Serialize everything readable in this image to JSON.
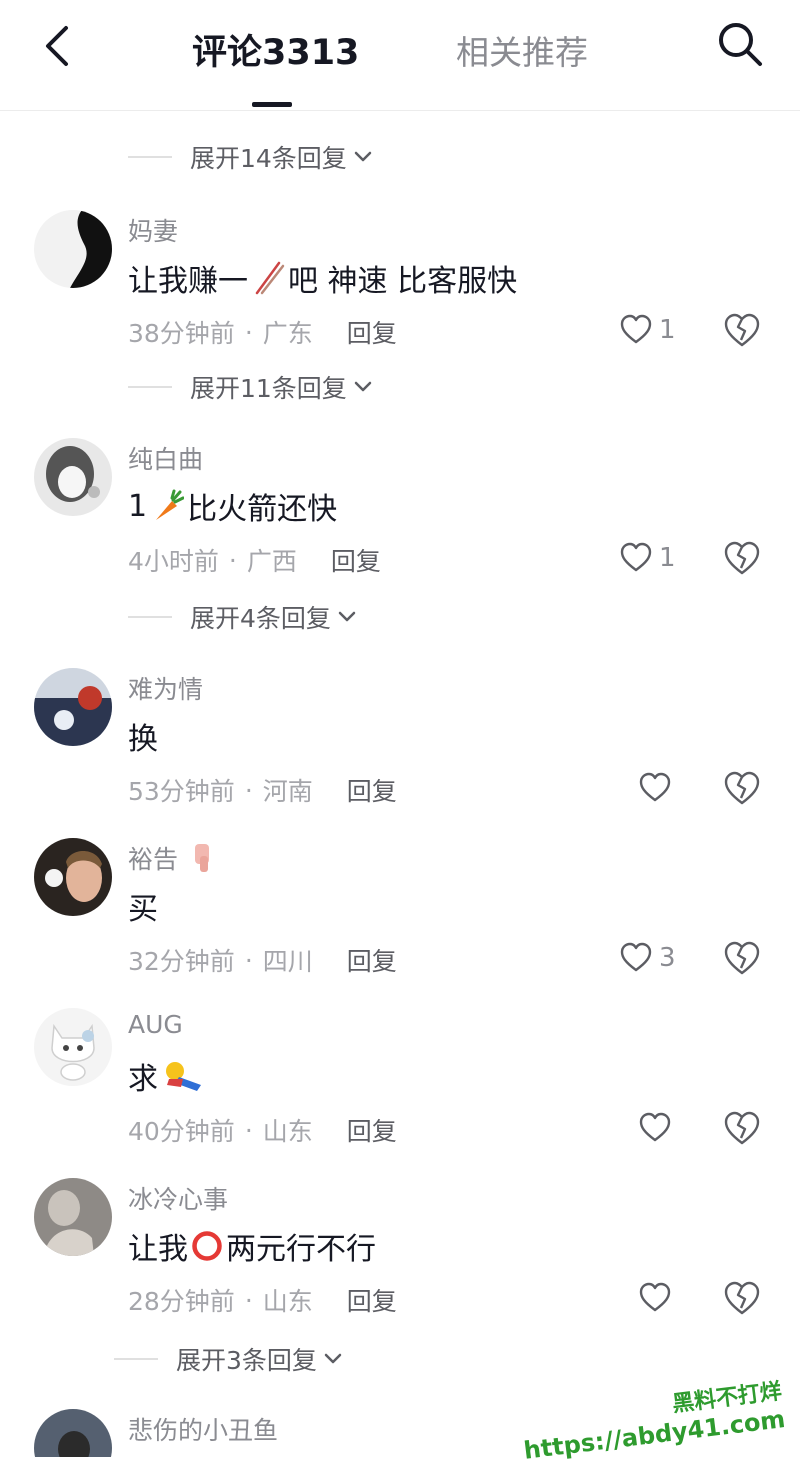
{
  "header": {
    "tab_comments": "评论3313",
    "tab_related": "相关推荐"
  },
  "expanders": [
    "展开14条回复",
    "展开11条回复",
    "展开4条回复",
    "展开3条回复"
  ],
  "comments": [
    {
      "username": "妈妻",
      "text_before": "让我赚一",
      "emoji": "chopsticks",
      "text_after": "吧 神速 比客服快",
      "time": "38分钟前",
      "sep": "·",
      "region": "广东",
      "reply": "回复",
      "likes": "1"
    },
    {
      "username": "纯白曲",
      "text_before": "1",
      "emoji": "carrot",
      "text_after": "比火箭还快",
      "time": "4小时前",
      "sep": "·",
      "region": "广西",
      "reply": "回复",
      "likes": "1"
    },
    {
      "username": "难为情",
      "text_before": "换",
      "emoji": "",
      "text_after": "",
      "time": "53分钟前",
      "sep": "·",
      "region": "河南",
      "reply": "回复",
      "likes": ""
    },
    {
      "username": "裕告",
      "text_before": "买",
      "emoji": "",
      "text_after": "",
      "time": "32分钟前",
      "sep": "·",
      "region": "四川",
      "reply": "回复",
      "likes": "3"
    },
    {
      "username": "AUG",
      "text_before": "求",
      "emoji": "lying-emoji",
      "text_after": "",
      "time": "40分钟前",
      "sep": "·",
      "region": "山东",
      "reply": "回复",
      "likes": ""
    },
    {
      "username": "冰冷心事",
      "text_before": "让我",
      "emoji": "red-circle",
      "text_after": "两元行不行",
      "time": "28分钟前",
      "sep": "·",
      "region": "山东",
      "reply": "回复",
      "likes": ""
    },
    {
      "username": "悲伤的小丑鱼"
    }
  ],
  "watermark": {
    "line1": "黑料不打烊",
    "line2": "https://abdy41.com"
  },
  "colors": {
    "text_primary": "#161823",
    "text_secondary": "#8a8b91",
    "watermark_green": "#2e9b2e"
  }
}
